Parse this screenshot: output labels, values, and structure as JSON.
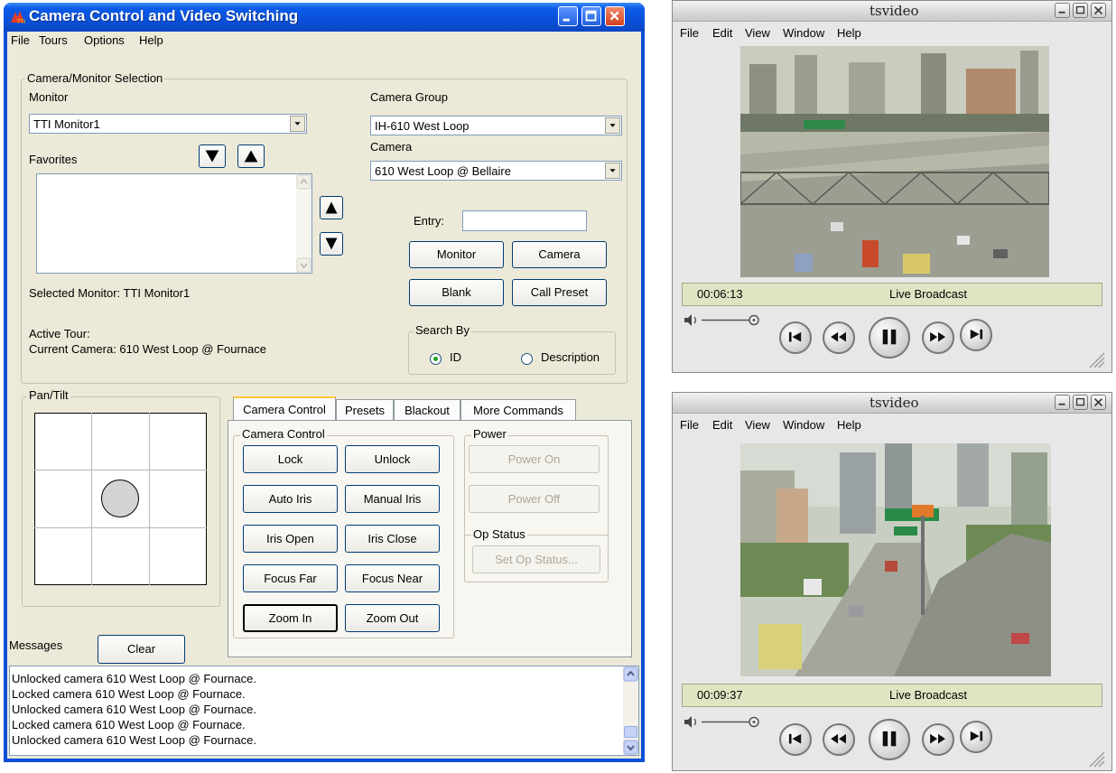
{
  "main": {
    "title": "Camera Control and Video Switching",
    "menu": [
      "File",
      "Tours",
      "Options",
      "Help"
    ],
    "selection_group_label": "Camera/Monitor Selection",
    "monitor_label": "Monitor",
    "monitor_value": "TTI Monitor1",
    "camera_group_label": "Camera Group",
    "camera_group_value": "IH-610 West Loop",
    "camera_label": "Camera",
    "camera_value": "610 West Loop @ Bellaire",
    "favorites_label": "Favorites",
    "entry_label": "Entry:",
    "entry_value": "",
    "monitor_button": "Monitor",
    "camera_button": "Camera",
    "blank_button": "Blank",
    "call_preset_button": "Call Preset",
    "selected_monitor_text": "Selected Monitor:  TTI Monitor1",
    "active_tour_text": "Active Tour:",
    "current_camera_text": "Current Camera:   610 West Loop @ Fournace",
    "search_by_label": "Search By",
    "search_id_label": "ID",
    "search_desc_label": "Description",
    "search_selected": "ID",
    "pan_tilt_label": "Pan/Tilt",
    "tabs": [
      "Camera Control",
      "Presets",
      "Blackout",
      "More Commands"
    ],
    "active_tab": "Camera Control",
    "camera_control_group": "Camera Control",
    "camera_buttons": [
      "Lock",
      "Unlock",
      "Auto Iris",
      "Manual Iris",
      "Iris Open",
      "Iris Close",
      "Focus Far",
      "Focus Near",
      "Zoom In",
      "Zoom Out"
    ],
    "power_group": "Power",
    "power_on": "Power On",
    "power_off": "Power Off",
    "op_status_group": "Op Status",
    "set_op_status": "Set Op Status...",
    "messages_label": "Messages",
    "clear_button": "Clear",
    "messages": [
      "Unlocked camera 610 West Loop @ Fournace.",
      "Locked camera 610 West Loop @ Fournace.",
      "Unlocked camera 610 West Loop @ Fournace.",
      "Locked camera 610 West Loop @ Fournace.",
      "Unlocked camera 610 West Loop @ Fournace."
    ]
  },
  "video_windows": [
    {
      "title": "tsvideo",
      "menu": [
        "File",
        "Edit",
        "View",
        "Window",
        "Help"
      ],
      "time": "00:06:13",
      "status": "Live Broadcast"
    },
    {
      "title": "tsvideo",
      "menu": [
        "File",
        "Edit",
        "View",
        "Window",
        "Help"
      ],
      "time": "00:09:37",
      "status": "Live Broadcast"
    }
  ],
  "colors": {
    "xp_blue": "#0a50d8",
    "dialog_bg": "#ece9d8",
    "status_bar": "#dfe5c2"
  }
}
